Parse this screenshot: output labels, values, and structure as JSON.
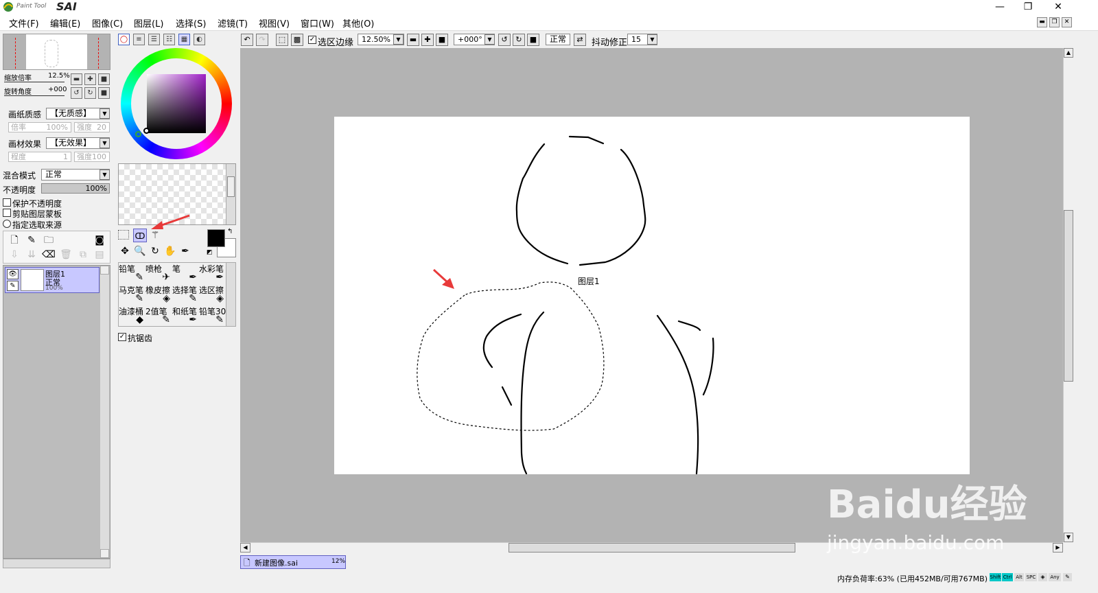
{
  "app": {
    "logo_text": "Paint Tool SAI",
    "window_controls": {
      "minimize": "—",
      "restore": "❐",
      "close": "✕"
    }
  },
  "menu": [
    {
      "label": "文件(F)"
    },
    {
      "label": "编辑(E)"
    },
    {
      "label": "图像(C)"
    },
    {
      "label": "图层(L)"
    },
    {
      "label": "选择(S)"
    },
    {
      "label": "滤镜(T)"
    },
    {
      "label": "视图(V)"
    },
    {
      "label": "窗口(W)"
    },
    {
      "label": "其他(O)"
    }
  ],
  "navigator": {
    "zoom_label": "缩放倍率",
    "zoom_value": "12.5%",
    "rotate_label": "旋转角度",
    "rotate_value": "+000"
  },
  "paper": {
    "texture_label": "画纸质感",
    "texture_value": "【无质感】",
    "rate_label": "倍率",
    "rate_value": "100%",
    "strength_label": "强度",
    "strength_value": "20",
    "effect_label": "画材效果",
    "effect_value": "【无效果】",
    "degree_label": "程度",
    "degree_value": "1",
    "effect_strength_label": "强度",
    "effect_strength_value": "100"
  },
  "layer_props": {
    "blend_label": "混合模式",
    "blend_value": "正常",
    "opacity_label": "不透明度",
    "opacity_value": "100%",
    "opacity_fraction": 1.0,
    "protect_opacity": "保护不透明度",
    "clip_mask": "剪贴图层蒙板",
    "selection_source": "指定选取来源"
  },
  "layers": [
    {
      "name": "图层1",
      "mode": "正常",
      "opacity": "100%"
    }
  ],
  "brushes": [
    {
      "label": "铅笔",
      "icon": "✎"
    },
    {
      "label": "喷枪",
      "icon": "✈"
    },
    {
      "label": "笔",
      "icon": "✒"
    },
    {
      "label": "水彩笔",
      "icon": "✒"
    },
    {
      "label": "马克笔",
      "icon": "✎"
    },
    {
      "label": "橡皮擦",
      "icon": "◈"
    },
    {
      "label": "选择笔",
      "icon": "✎"
    },
    {
      "label": "选区擦",
      "icon": "◈"
    },
    {
      "label": "油漆桶",
      "icon": "◆"
    },
    {
      "label": "2值笔",
      "icon": "✎"
    },
    {
      "label": "和纸笔",
      "icon": "✒"
    },
    {
      "label": "铅笔30",
      "icon": "✎"
    }
  ],
  "antialias_label": "抗锯齿",
  "toolbar": {
    "selection_edge_label": "选区边缘",
    "zoom_value": "12.50%",
    "rotation_value": "+000°",
    "blend_value": "正常",
    "stabilizer_label": "抖动修正",
    "stabilizer_value": "15"
  },
  "canvas": {
    "layer_popup": "图层1"
  },
  "tabs": [
    {
      "label": "新建图像.sai",
      "zoom": "12%"
    }
  ],
  "status": {
    "memory_text": "内存负荷率:63% (已用452MB/可用767MB)",
    "keys": [
      "Shift",
      "Ctrl",
      "Alt",
      "SPC",
      "Any"
    ]
  },
  "watermark": {
    "brand": "Baidu经验",
    "url": "jingyan.baidu.com"
  },
  "colors": {
    "accent": "#c8c8ff",
    "selected_layer": "#c8c8ff",
    "canvas_bg": "#b3b3b3",
    "key_active": "#00c8c8"
  }
}
